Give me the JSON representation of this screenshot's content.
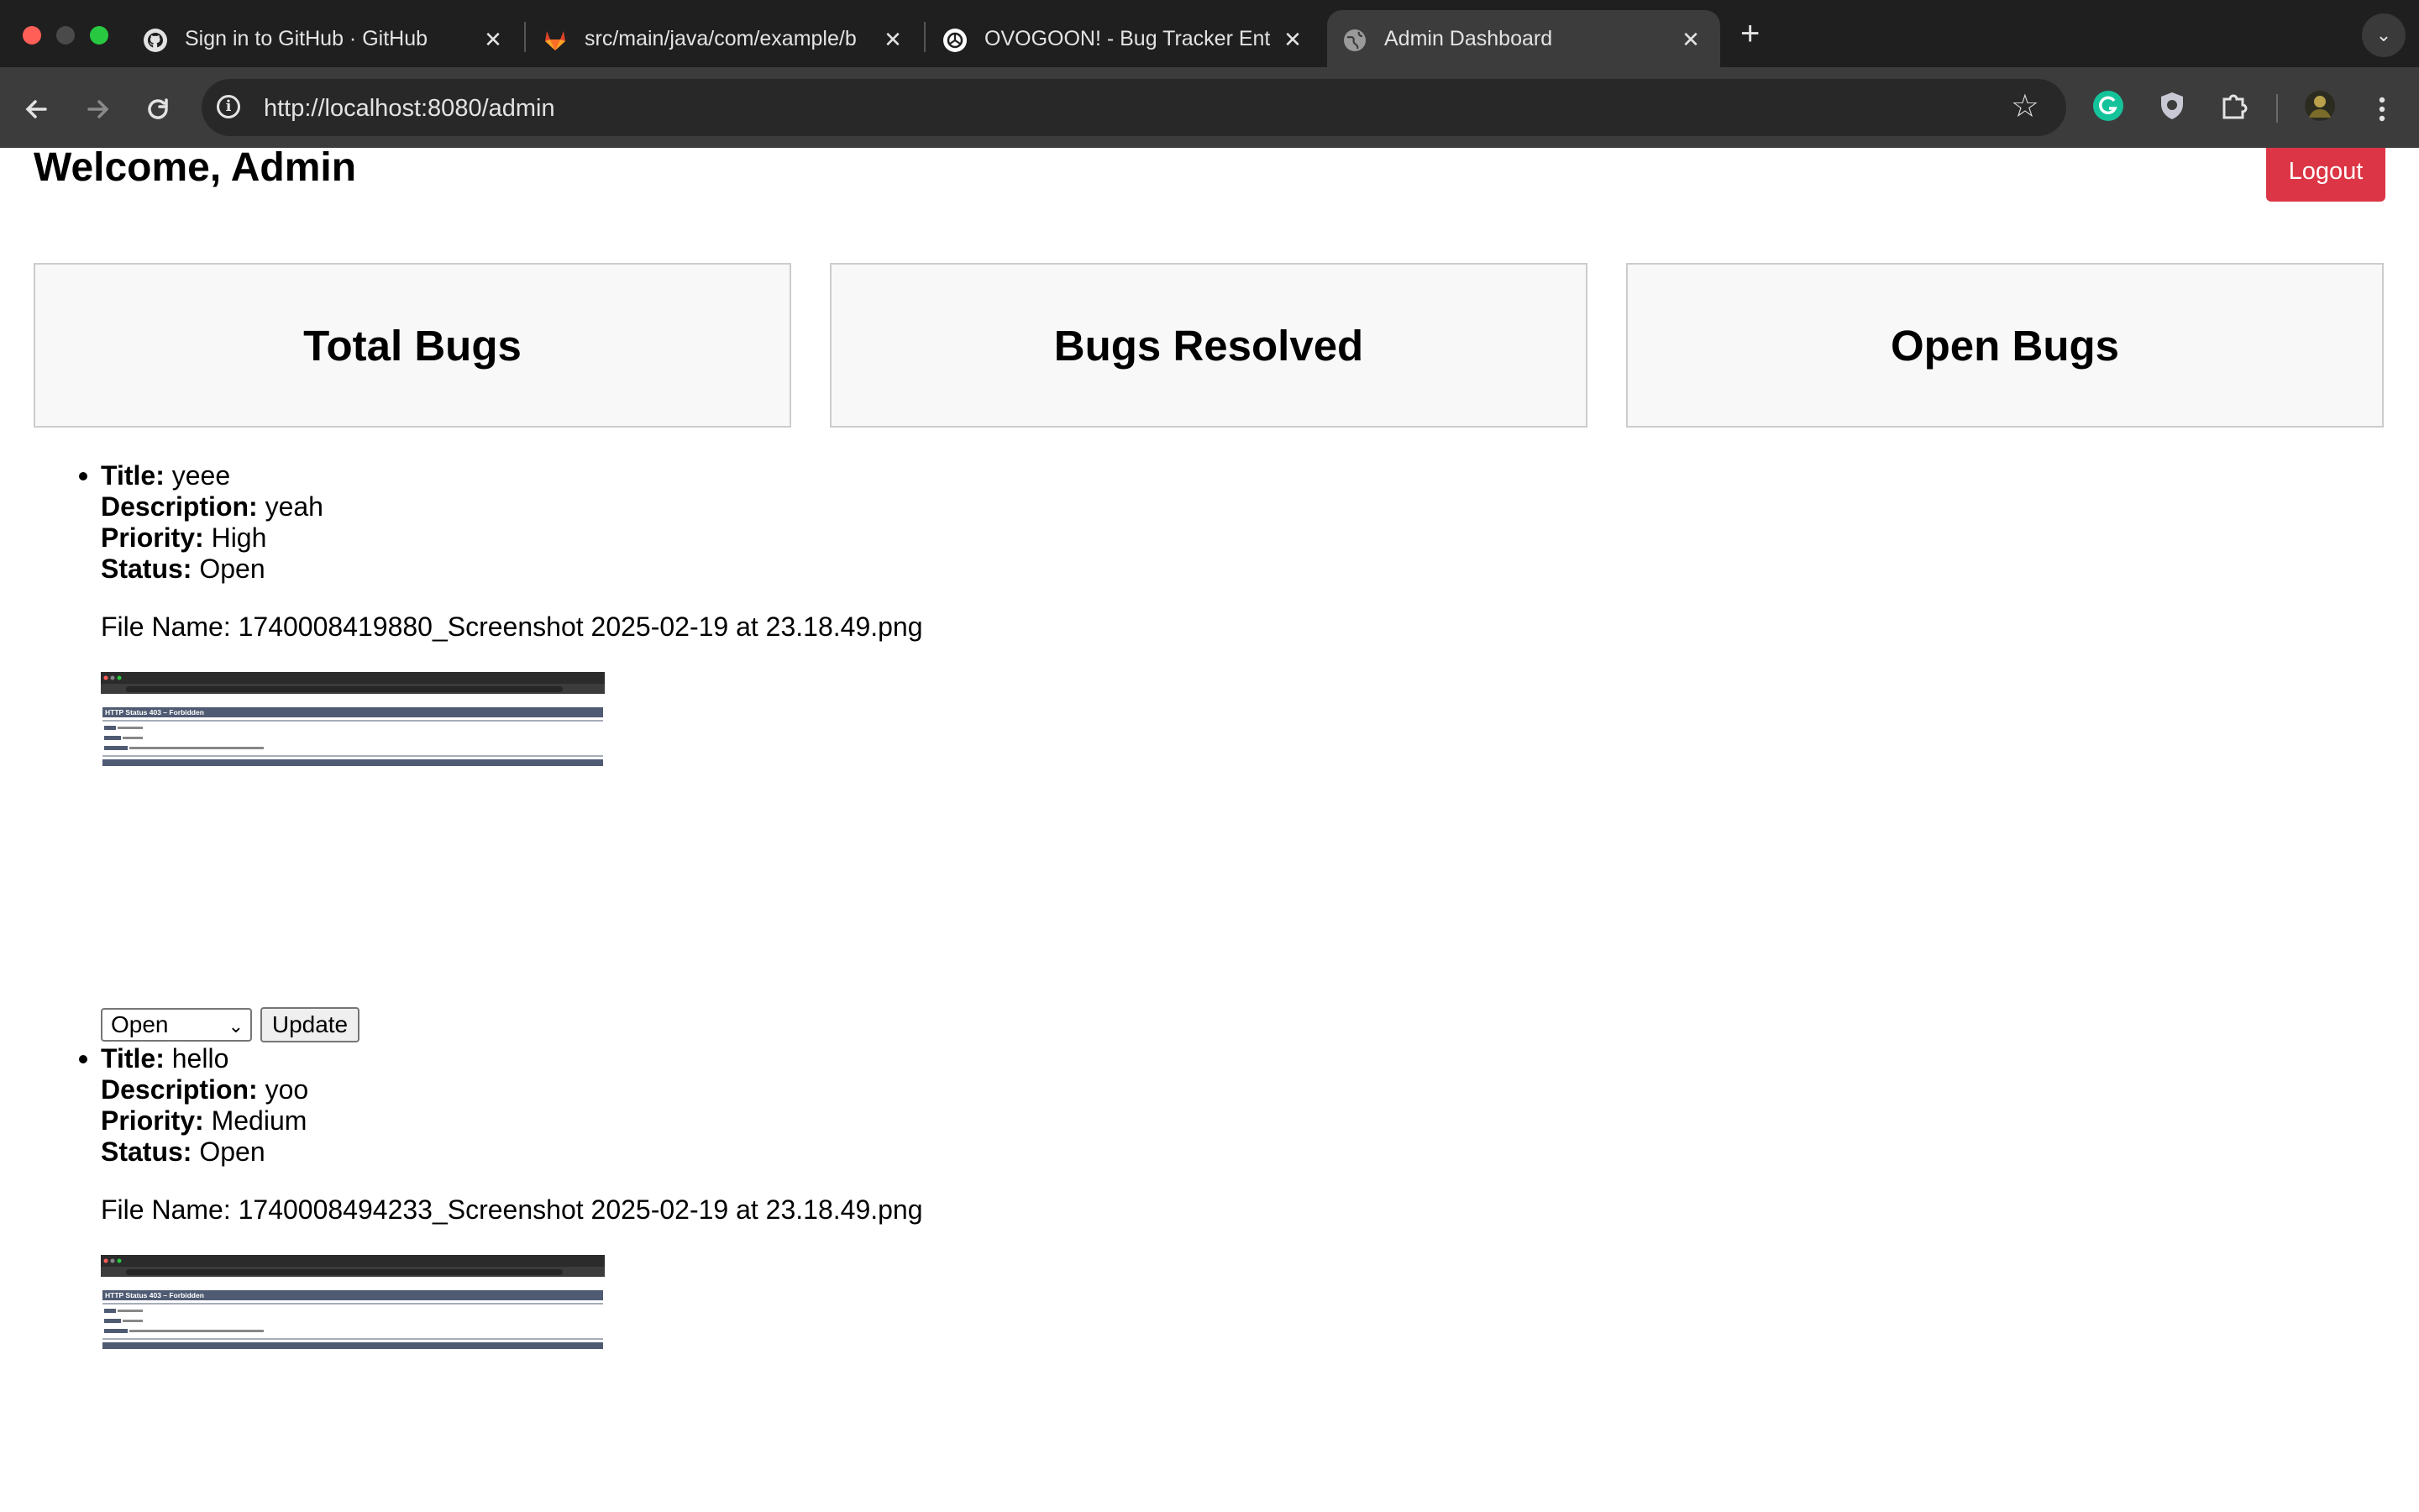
{
  "browser": {
    "tabs": [
      {
        "title": "Sign in to GitHub · GitHub",
        "icon": "github-icon"
      },
      {
        "title": "src/main/java/com/example/b",
        "icon": "gitlab-icon"
      },
      {
        "title": "OVOGOON! - Bug Tracker Ent",
        "icon": "chatgpt-icon"
      },
      {
        "title": "Admin Dashboard",
        "icon": "globe-icon",
        "active": true
      }
    ],
    "url": "http://localhost:8080/admin"
  },
  "page": {
    "welcome": "Welcome, Admin",
    "logout_label": "Logout",
    "cards": [
      {
        "title": "Total Bugs"
      },
      {
        "title": "Bugs Resolved"
      },
      {
        "title": "Open Bugs"
      }
    ],
    "labels": {
      "title": "Title:",
      "description": "Description:",
      "priority": "Priority:",
      "status": "Status:",
      "file_name": "File Name:",
      "update": "Update"
    },
    "bugs": [
      {
        "title": "yeee",
        "description": "yeah",
        "priority": "High",
        "status": "Open",
        "file_name": "1740008419880_Screenshot 2025-02-19 at 23.18.49.png",
        "selected_status": "Open",
        "thumbnail_heading": "HTTP Status 403 – Forbidden"
      },
      {
        "title": "hello",
        "description": "yoo",
        "priority": "Medium",
        "status": "Open",
        "file_name": "1740008494233_Screenshot 2025-02-19 at 23.18.49.png",
        "selected_status": "Open",
        "thumbnail_heading": "HTTP Status 403 – Forbidden"
      }
    ]
  },
  "colors": {
    "logout": "#dc3545",
    "card_bg": "#f8f8f8",
    "chrome_dark": "#1f1f1f",
    "toolbar": "#3c3c3c"
  }
}
